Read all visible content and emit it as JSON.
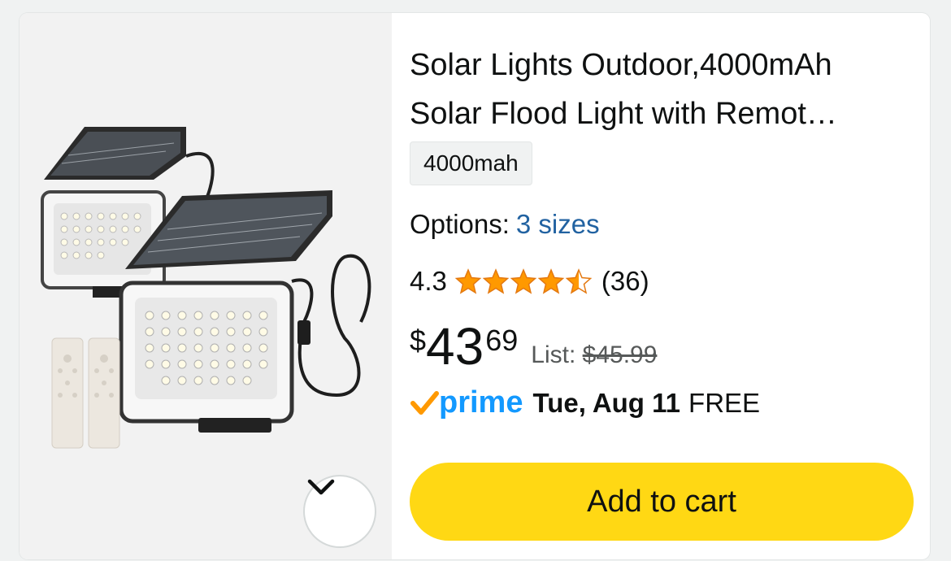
{
  "product": {
    "title": "Solar Lights Outdoor,4000mAh Solar Flood Light with Remot…",
    "variant": "4000mah",
    "options_label": "Options:",
    "options_link": "3 sizes",
    "rating": "4.3",
    "rating_value": 4.3,
    "review_count": "(36)",
    "price_symbol": "$",
    "price_whole": "43",
    "price_fraction": "69",
    "list_label": "List:",
    "list_price": "$45.99",
    "prime_label": "prime",
    "delivery_date": "Tue, Aug 11",
    "delivery_cost": "FREE",
    "add_to_cart": "Add to cart"
  },
  "colors": {
    "star": "#ff9900",
    "link": "#2162a1",
    "prime": "#1399ff",
    "prime_check": "#ff9900",
    "cart_button": "#ffd814"
  },
  "icons": {
    "expand": "chevron-down-icon",
    "prime": "prime-check-icon",
    "star": "star-icon"
  }
}
